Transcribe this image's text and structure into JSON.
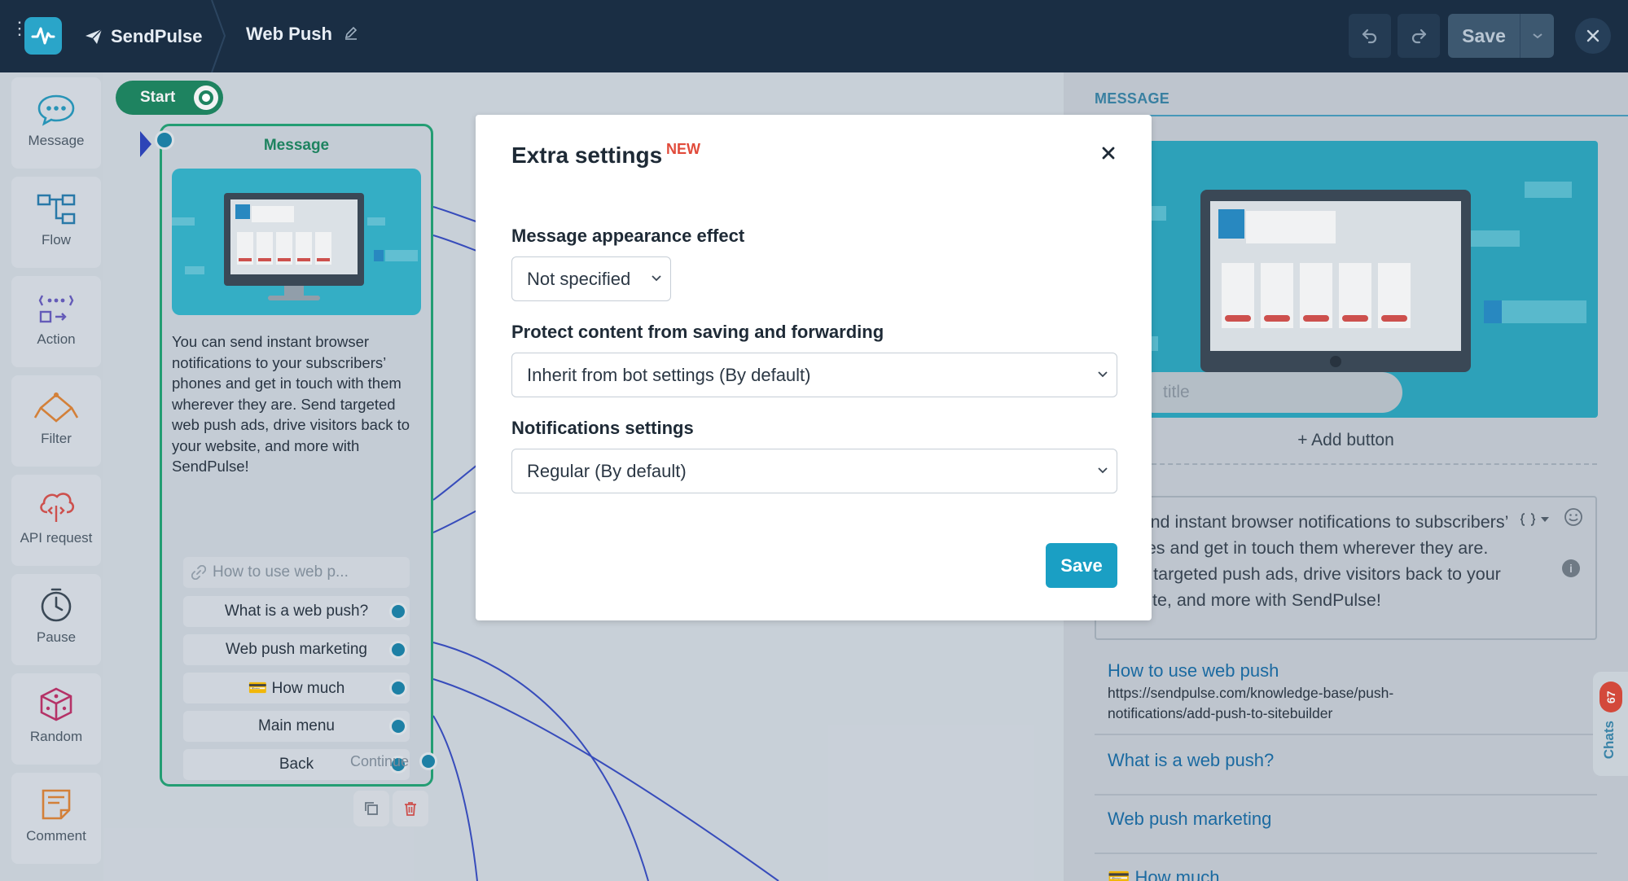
{
  "topbar": {
    "brand": "SendPulse",
    "page_title": "Web Push",
    "save_label": "Save"
  },
  "toolbar": {
    "items": [
      {
        "label": "Message",
        "icon": "message-bubble-icon"
      },
      {
        "label": "Flow",
        "icon": "flow-icon"
      },
      {
        "label": "Action",
        "icon": "action-icon"
      },
      {
        "label": "Filter",
        "icon": "filter-icon"
      },
      {
        "label": "API request",
        "icon": "cloud-api-icon"
      },
      {
        "label": "Pause",
        "icon": "clock-icon"
      },
      {
        "label": "Random",
        "icon": "dice-icon"
      },
      {
        "label": "Comment",
        "icon": "comment-icon"
      }
    ]
  },
  "canvas": {
    "start_label": "Start",
    "node": {
      "title": "Message",
      "text": "You can send instant browser notifications to your subscribers’ phones and get in touch with them wherever they are. Send targeted web push ads, drive visitors back to your website, and more with SendPulse!",
      "link_button": "How to use web p...",
      "buttons": [
        "What is a web push?",
        "Web push marketing",
        "💳 How much",
        "Main menu",
        "Back"
      ],
      "continue_label": "Continue"
    }
  },
  "panel": {
    "heading": "MESSAGE",
    "title_placeholder": "title",
    "add_button": "+ Add button",
    "text": "an send instant browser notifications to subscribers’ phones and get in touch them wherever they are. Send targeted push ads, drive visitors back to your website, and more with SendPulse!",
    "buttons": [
      {
        "label": "How to use web push",
        "url": "https://sendpulse.com/knowledge-base/push-notifications/add-push-to-sitebuilder"
      },
      {
        "label": "What is a web push?"
      },
      {
        "label": "Web push marketing"
      },
      {
        "label": "💳 How much"
      }
    ],
    "chats_label": "Chats",
    "chats_count": "67"
  },
  "modal": {
    "title": "Extra settings",
    "badge": "NEW",
    "fields": [
      {
        "label": "Message appearance effect",
        "value": "Not specified"
      },
      {
        "label": "Protect content from saving and forwarding",
        "value": "Inherit from bot settings (By default)"
      },
      {
        "label": "Notifications settings",
        "value": "Regular (By default)"
      }
    ],
    "save_label": "Save"
  },
  "colors": {
    "topbar": "#1a2e44",
    "accent": "#1a9fc4",
    "node_border": "#25a577",
    "badge_new": "#e14b3b",
    "link": "#1c6fa8"
  }
}
